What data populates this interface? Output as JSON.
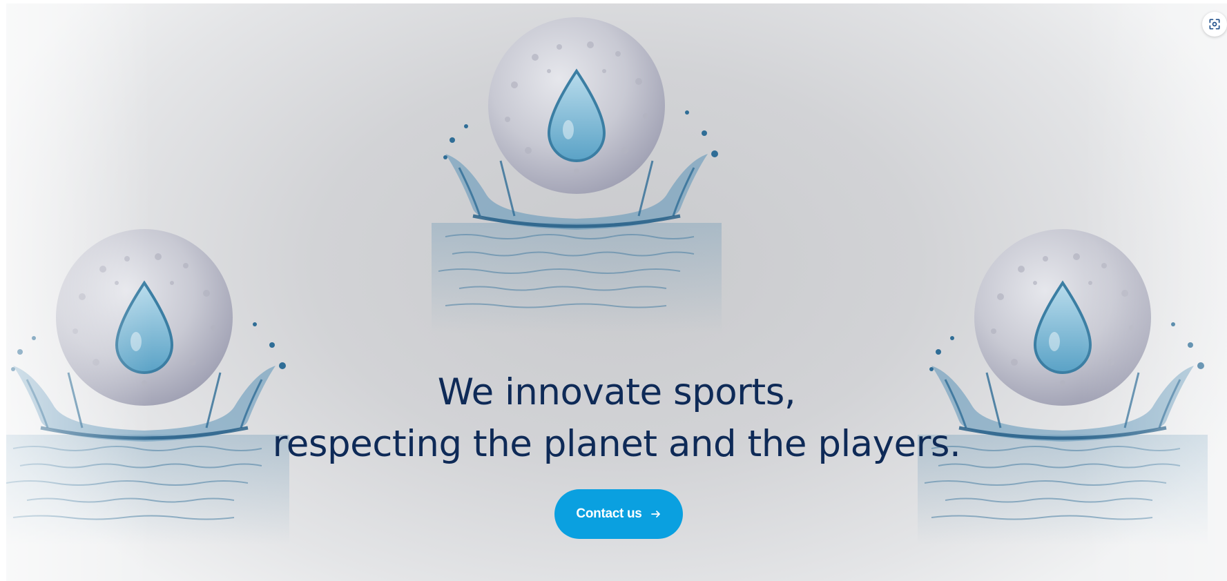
{
  "hero": {
    "headline_line1": "We innovate sports,",
    "headline_line2": "respecting the planet and the players.",
    "cta_label": "Contact us",
    "cta_icon": "arrow-right-icon",
    "fullscreen_icon": "focus-capture-icon"
  },
  "colors": {
    "headline": "#0e2a57",
    "cta_background": "#0aa0e0",
    "cta_text": "#ffffff",
    "water": "#3d7fa8",
    "ball": "#c7c8d2"
  }
}
